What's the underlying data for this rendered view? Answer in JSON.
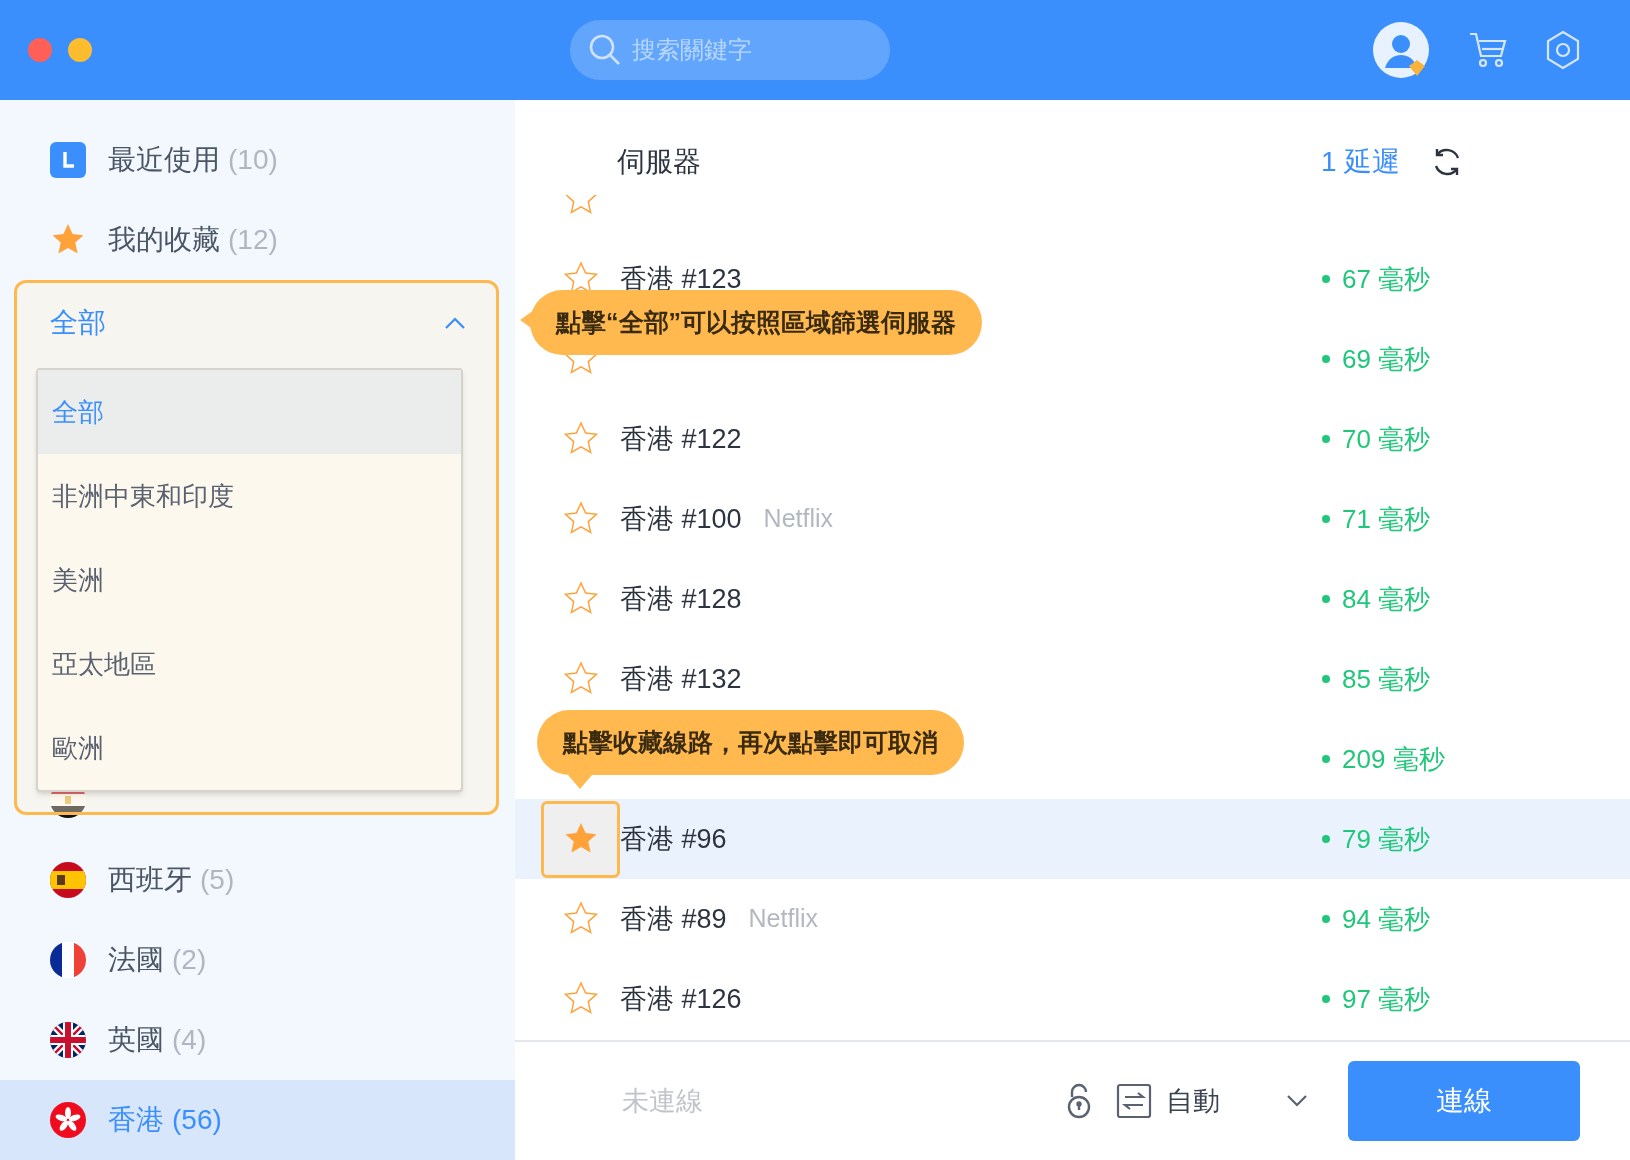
{
  "search": {
    "placeholder": "搜索關鍵字"
  },
  "sidebar": {
    "top_items": [
      {
        "kind": "recent",
        "label": "最近使用",
        "count": "(10)",
        "selected": false
      },
      {
        "kind": "favorites",
        "label": "我的收藏",
        "count": "(12)",
        "selected": false
      }
    ],
    "region_filter": {
      "label": "全部",
      "expanded": true,
      "options": [
        {
          "label": "全部",
          "selected": true
        },
        {
          "label": "非洲中東和印度",
          "selected": false
        },
        {
          "label": "美洲",
          "selected": false
        },
        {
          "label": "亞太地區",
          "selected": false
        },
        {
          "label": "歐洲",
          "selected": false
        }
      ]
    },
    "countries": [
      {
        "kind": "egypt",
        "selected": false
      },
      {
        "kind": "spain",
        "label": "西班牙",
        "count": "(5)",
        "selected": false
      },
      {
        "kind": "france",
        "label": "法國",
        "count": "(2)",
        "selected": false
      },
      {
        "kind": "uk",
        "label": "英國",
        "count": "(4)",
        "selected": false
      },
      {
        "kind": "hongkong",
        "label": "香港",
        "count": "(56)",
        "selected": true
      }
    ]
  },
  "server_list": {
    "column": "伺服器",
    "sort": "1 延遲",
    "rows": [
      {
        "favorite": false,
        "selected": false
      },
      {
        "name": "香港 #123",
        "latency": "67 毫秒",
        "favorite": false,
        "selected": false,
        "highlighted": false
      },
      {
        "latency": "69 毫秒",
        "favorite": false,
        "selected": false,
        "highlighted": false
      },
      {
        "name": "香港 #122",
        "latency": "70 毫秒",
        "favorite": false,
        "selected": false,
        "highlighted": false
      },
      {
        "name": "香港 #100",
        "tag": "Netflix",
        "latency": "71 毫秒",
        "favorite": false,
        "selected": false,
        "highlighted": false
      },
      {
        "name": "香港 #128",
        "latency": "84 毫秒",
        "favorite": false,
        "selected": false,
        "highlighted": false
      },
      {
        "name": "香港 #132",
        "latency": "85 毫秒",
        "favorite": false,
        "selected": false,
        "highlighted": false
      },
      {
        "latency": "209 毫秒",
        "selected": false,
        "highlighted": false
      },
      {
        "name": "香港 #96",
        "latency": "79 毫秒",
        "favorite": true,
        "selected": true,
        "highlighted": true
      },
      {
        "name": "香港 #89",
        "tag": "Netflix",
        "latency": "94 毫秒",
        "favorite": false,
        "selected": false,
        "highlighted": false
      },
      {
        "name": "香港 #126",
        "latency": "97 毫秒",
        "favorite": false,
        "selected": false,
        "highlighted": false
      }
    ]
  },
  "status_bar": {
    "status": "未連線",
    "mode": "自動",
    "connect_button": "連線"
  },
  "tooltips": [
    {
      "text": "點擊“全部”可以按照區域篩選伺服器"
    },
    {
      "text": "點擊收藏線路，再次點擊即可取消"
    }
  ]
}
